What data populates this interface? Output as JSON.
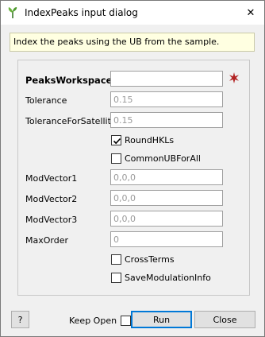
{
  "window": {
    "title": "IndexPeaks input dialog",
    "icon": "mantid-plant-icon",
    "close_glyph": "✕"
  },
  "info": {
    "text": "Index the peaks using the UB from the sample."
  },
  "form": {
    "peaks_workspace": {
      "label": "PeaksWorkspace",
      "value": "",
      "mandatory": true
    },
    "tolerance": {
      "label": "Tolerance",
      "placeholder": "0.15"
    },
    "tolerance_satellite": {
      "label": "ToleranceForSatellite",
      "placeholder": "0.15"
    },
    "round_hkls": {
      "label": "RoundHKLs",
      "checked": true
    },
    "common_ub": {
      "label": "CommonUBForAll",
      "checked": false
    },
    "mod_vector1": {
      "label": "ModVector1",
      "placeholder": "0,0,0"
    },
    "mod_vector2": {
      "label": "ModVector2",
      "placeholder": "0,0,0"
    },
    "mod_vector3": {
      "label": "ModVector3",
      "placeholder": "0,0,0"
    },
    "max_order": {
      "label": "MaxOrder",
      "placeholder": "0"
    },
    "cross_terms": {
      "label": "CrossTerms",
      "checked": false
    },
    "save_mod_info": {
      "label": "SaveModulationInfo",
      "checked": false
    }
  },
  "footer": {
    "help_label": "?",
    "keep_open_label": "Keep Open",
    "keep_open_checked": false,
    "run_label": "Run",
    "close_label": "Close"
  },
  "colors": {
    "mandatory_star": "#b22222",
    "info_background": "#ffffe1",
    "primary_border": "#0078d7"
  }
}
